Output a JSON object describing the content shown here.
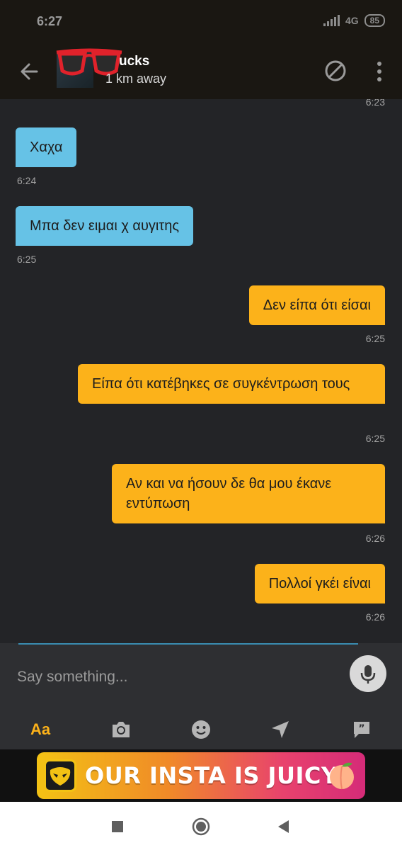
{
  "status_bar": {
    "time": "6:27",
    "network": "4G",
    "battery": "85"
  },
  "header": {
    "contact_name": "ucks",
    "distance": "1 km away"
  },
  "messages": [
    {
      "direction": "out",
      "text": "",
      "time": "6:23"
    },
    {
      "direction": "in",
      "text": "Χαχα",
      "time": "6:24"
    },
    {
      "direction": "in",
      "text": "Μπα δεν ειμαι χ αυγιτης",
      "time": "6:25"
    },
    {
      "direction": "out",
      "text": "Δεν είπα ότι είσαι",
      "time": "6:25"
    },
    {
      "direction": "out",
      "text": "Είπα ότι κατέβηκες σε συγκέντρωση τους",
      "time": "6:25"
    },
    {
      "direction": "out",
      "text": "Αν και να ήσουν δε θα μου έκανε εντύπωση",
      "time": "6:26"
    },
    {
      "direction": "out",
      "text": "Πολλοί γκέι είναι",
      "time": "6:26"
    }
  ],
  "input": {
    "placeholder": "Say something..."
  },
  "toolbar": {
    "text_label": "Aa"
  },
  "banner": {
    "text": "OUR INSTA IS JUICY"
  },
  "colors": {
    "incoming": "#66c2e6",
    "outgoing": "#fcb21a",
    "accent": "#fcb21a",
    "background": "#232427"
  },
  "icons": [
    "back-arrow-icon",
    "block-icon",
    "more-vert-icon",
    "mic-icon",
    "camera-icon",
    "emoji-icon",
    "location-icon",
    "saved-phrases-icon",
    "grindr-mask-icon",
    "peach-icon",
    "nav-square-icon",
    "nav-circle-icon",
    "nav-back-icon"
  ]
}
